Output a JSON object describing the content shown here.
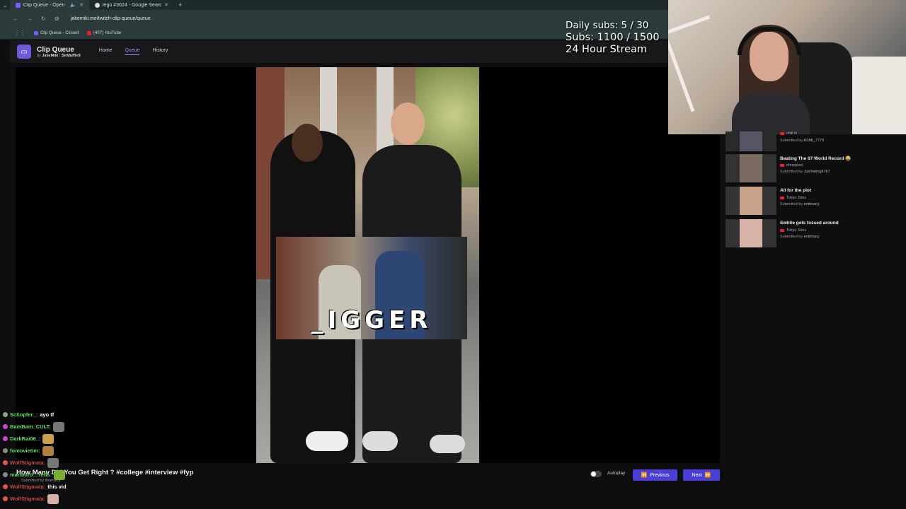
{
  "browser": {
    "tabs": [
      {
        "label": "Clip Queue - Open",
        "active": true
      },
      {
        "label": "lego #3024 - Google Search",
        "active": false
      }
    ],
    "url": "jakemiki.me/twitch-clip-queue/queue",
    "bookmarks": [
      "Clip Queue - Closed",
      "(407) YouTube"
    ]
  },
  "app": {
    "title": "Clip Queue",
    "by": "by",
    "author1": "JakeMiki",
    "author2": "SirMuffin9",
    "nav": [
      "Home",
      "Queue",
      "History"
    ]
  },
  "player": {
    "caption": "_IGGER",
    "clip_title": "How Many Did You Get Right ? #college #interview #fyp",
    "clip_sub": "Submitted by itsamacy",
    "autoplay_label": "Autoplay",
    "prev_label": "Previous",
    "next_label": "Next"
  },
  "overlay": {
    "daily": "Daily subs: 5 / 30",
    "subs": "Subs: 1100 / 1500",
    "stream": "24 Hour Stream"
  },
  "queue": [
    {
      "title": "",
      "channel": "chill fx",
      "submitter": "ASMI_7770"
    },
    {
      "title": "Beating The 67 World Record 😂",
      "channel": "ohnepixel",
      "submitter": "JusYoking6767"
    },
    {
      "title": "All for the plot",
      "channel": "Tokyo Sims",
      "submitter": "entimacy"
    },
    {
      "title": "Swhite gets tossed around",
      "channel": "Tokyo Sims",
      "submitter": "entimacy"
    }
  ],
  "queue_labels": {
    "submitted_by": "Submitted by"
  },
  "chat": [
    {
      "user": "Schopfer_:",
      "msg": "ayo tf",
      "color": "#5ee05a"
    },
    {
      "user": "BamBam_CULT:",
      "msg": "",
      "color": "#5ee05a"
    },
    {
      "user": "DarkRai06_:",
      "msg": "",
      "color": "#5ee05a"
    },
    {
      "user": "fomovietim:",
      "msg": "",
      "color": "#5ee05a"
    },
    {
      "user": "WolfStigmata:",
      "msg": "",
      "color": "#d04a4a"
    },
    {
      "user": "marlboro__reds:",
      "msg": "",
      "color": "#5ee05a"
    },
    {
      "user": "WolfStigmata:",
      "msg": "this vid",
      "color": "#d04a4a"
    },
    {
      "user": "WolfStigmata:",
      "msg": "",
      "color": "#d04a4a"
    }
  ]
}
